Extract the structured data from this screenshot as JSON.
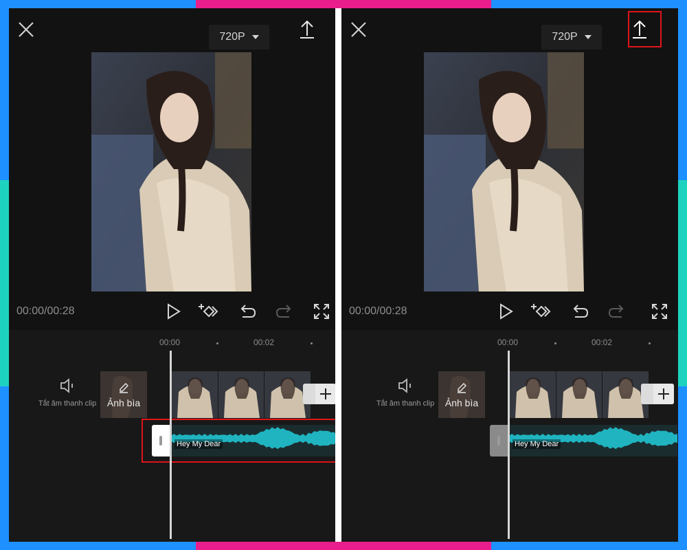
{
  "panels": [
    {
      "id": "left",
      "resolution_label": "720P",
      "timecode": "00:00/00:28",
      "ruler": {
        "t0": "00:00",
        "t1": "00:02"
      },
      "mute": {
        "label": "Tắt âm thanh clip"
      },
      "cover": {
        "label": "Ảnh bìa"
      },
      "audio": {
        "name": "Hey My Dear"
      },
      "highlight": "audio"
    },
    {
      "id": "right",
      "resolution_label": "720P",
      "timecode": "00:00/00:28",
      "ruler": {
        "t0": "00:00",
        "t1": "00:02"
      },
      "mute": {
        "label": "Tắt âm thanh clip"
      },
      "cover": {
        "label": "Ảnh bìa"
      },
      "audio": {
        "name": "Hey My Dear"
      },
      "highlight": "export"
    }
  ],
  "icons": {
    "close": "close-icon",
    "resolution_caret": "chevron-down-icon",
    "export": "upload-icon",
    "play": "play-icon",
    "keyframe": "keyframe-add-icon",
    "undo": "undo-icon",
    "redo": "redo-icon",
    "fullscreen": "fullscreen-icon",
    "mute": "speaker-mute-icon",
    "cover_edit": "pencil-icon",
    "add": "plus-icon"
  },
  "colors": {
    "accent_waveform": "#1fb4c0",
    "highlight_border": "#e0141a",
    "frame_blue": "#1e90ff",
    "frame_pink": "#e91e8c",
    "frame_teal": "#1dd3c0"
  }
}
